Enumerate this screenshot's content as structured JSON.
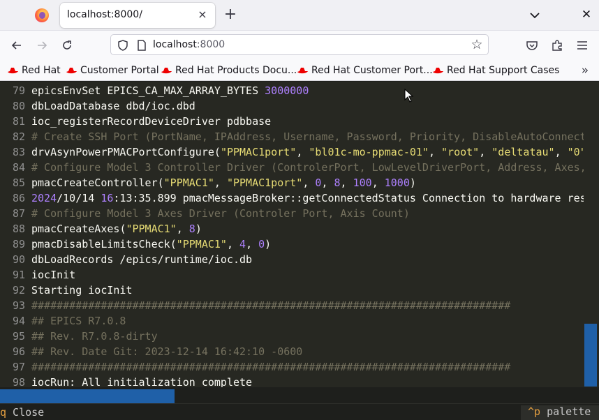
{
  "browser": {
    "tab": {
      "title": "localhost:8000/",
      "close_label": "×"
    },
    "new_tab_label": "+",
    "url": {
      "host": "localhost",
      "port": ":8000"
    },
    "bookmarks": [
      {
        "label": "Red Hat"
      },
      {
        "label": "Customer Portal"
      },
      {
        "label": "Red Hat Products Docu..."
      },
      {
        "label": "Red Hat Customer Port..."
      },
      {
        "label": "Red Hat Support Cases"
      }
    ],
    "bookmarks_overflow_label": "»",
    "colors": {
      "accent": "#1f60a8",
      "redhat": "#ee0000"
    }
  },
  "terminal": {
    "lines": [
      {
        "n": "79",
        "seg": [
          [
            "t",
            "epicsEnvSet EPICS_CA_MAX_ARRAY_BYTES "
          ],
          [
            "num",
            "3000000"
          ]
        ]
      },
      {
        "n": "80",
        "seg": [
          [
            "t",
            "dbLoadDatabase dbd/ioc.dbd"
          ]
        ]
      },
      {
        "n": "81",
        "seg": [
          [
            "t",
            "ioc_registerRecordDeviceDriver pdbbase"
          ]
        ]
      },
      {
        "n": "82",
        "seg": [
          [
            "cmt",
            "# Create SSH Port (PortName, IPAddress, Username, Password, Priority, DisableAutoConnect"
          ]
        ]
      },
      {
        "n": "83",
        "seg": [
          [
            "t",
            "drvAsynPowerPMACPortConfigure"
          ],
          [
            "pun",
            "("
          ],
          [
            "str",
            "\"PPMAC1port\""
          ],
          [
            "pun",
            ", "
          ],
          [
            "str",
            "\"bl01c-mo-ppmac-01\""
          ],
          [
            "pun",
            ", "
          ],
          [
            "str",
            "\"root\""
          ],
          [
            "pun",
            ", "
          ],
          [
            "str",
            "\"deltatau\""
          ],
          [
            "pun",
            ", "
          ],
          [
            "str",
            "\"0\""
          ]
        ]
      },
      {
        "n": "84",
        "seg": [
          [
            "cmt",
            "# Configure Model 3 Controller Driver (ControlerPort, LowLevelDriverPort, Address, Axes,"
          ]
        ]
      },
      {
        "n": "85",
        "seg": [
          [
            "t",
            "pmacCreateController"
          ],
          [
            "pun",
            "("
          ],
          [
            "str",
            "\"PPMAC1\""
          ],
          [
            "pun",
            ", "
          ],
          [
            "str",
            "\"PPMAC1port\""
          ],
          [
            "pun",
            ", "
          ],
          [
            "num",
            "0"
          ],
          [
            "pun",
            ", "
          ],
          [
            "num",
            "8"
          ],
          [
            "pun",
            ", "
          ],
          [
            "num",
            "100"
          ],
          [
            "pun",
            ", "
          ],
          [
            "num",
            "1000"
          ],
          [
            "pun",
            ")"
          ]
        ]
      },
      {
        "n": "86",
        "seg": [
          [
            "num",
            "2024"
          ],
          [
            "t",
            "/10/14 "
          ],
          [
            "num",
            "16"
          ],
          [
            "t",
            ":13:35.899 pmacMessageBroker::getConnectedStatus Connection to hardware res"
          ]
        ]
      },
      {
        "n": "87",
        "seg": [
          [
            "cmt",
            "# Configure Model 3 Axes Driver (Controler Port, Axis Count)"
          ]
        ]
      },
      {
        "n": "88",
        "seg": [
          [
            "t",
            "pmacCreateAxes"
          ],
          [
            "pun",
            "("
          ],
          [
            "str",
            "\"PPMAC1\""
          ],
          [
            "pun",
            ", "
          ],
          [
            "num",
            "8"
          ],
          [
            "pun",
            ")"
          ]
        ]
      },
      {
        "n": "89",
        "seg": [
          [
            "t",
            "pmacDisableLimitsCheck"
          ],
          [
            "pun",
            "("
          ],
          [
            "str",
            "\"PPMAC1\""
          ],
          [
            "pun",
            ", "
          ],
          [
            "num",
            "4"
          ],
          [
            "pun",
            ", "
          ],
          [
            "num",
            "0"
          ],
          [
            "pun",
            ")"
          ]
        ]
      },
      {
        "n": "90",
        "seg": [
          [
            "t",
            "dbLoadRecords /epics/runtime/ioc.db"
          ]
        ]
      },
      {
        "n": "91",
        "seg": [
          [
            "t",
            "iocInit"
          ]
        ]
      },
      {
        "n": "92",
        "seg": [
          [
            "t",
            "Starting iocInit"
          ]
        ]
      },
      {
        "n": "93",
        "seg": [
          [
            "cmt",
            "############################################################################"
          ]
        ]
      },
      {
        "n": "94",
        "seg": [
          [
            "cmt",
            "## EPICS R7.0.8"
          ]
        ]
      },
      {
        "n": "95",
        "seg": [
          [
            "cmt",
            "## Rev. R7.0.8-dirty"
          ]
        ]
      },
      {
        "n": "96",
        "seg": [
          [
            "cmt",
            "## Rev. Date Git: 2023-12-14 16:42:10 -0600"
          ]
        ]
      },
      {
        "n": "97",
        "seg": [
          [
            "cmt",
            "############################################################################"
          ]
        ]
      },
      {
        "n": "98",
        "seg": [
          [
            "t",
            "iocRun: All initialization complete"
          ]
        ]
      }
    ],
    "colors": {
      "bg": "#272822",
      "fg": "#f8f8f2",
      "number": "#ae81ff",
      "string": "#e6db74",
      "comment": "#75715e",
      "line_number": "#909090"
    }
  },
  "status": {
    "close_key": "q",
    "close_label": " Close",
    "palette_key": "^p",
    "palette_label": " palette"
  }
}
